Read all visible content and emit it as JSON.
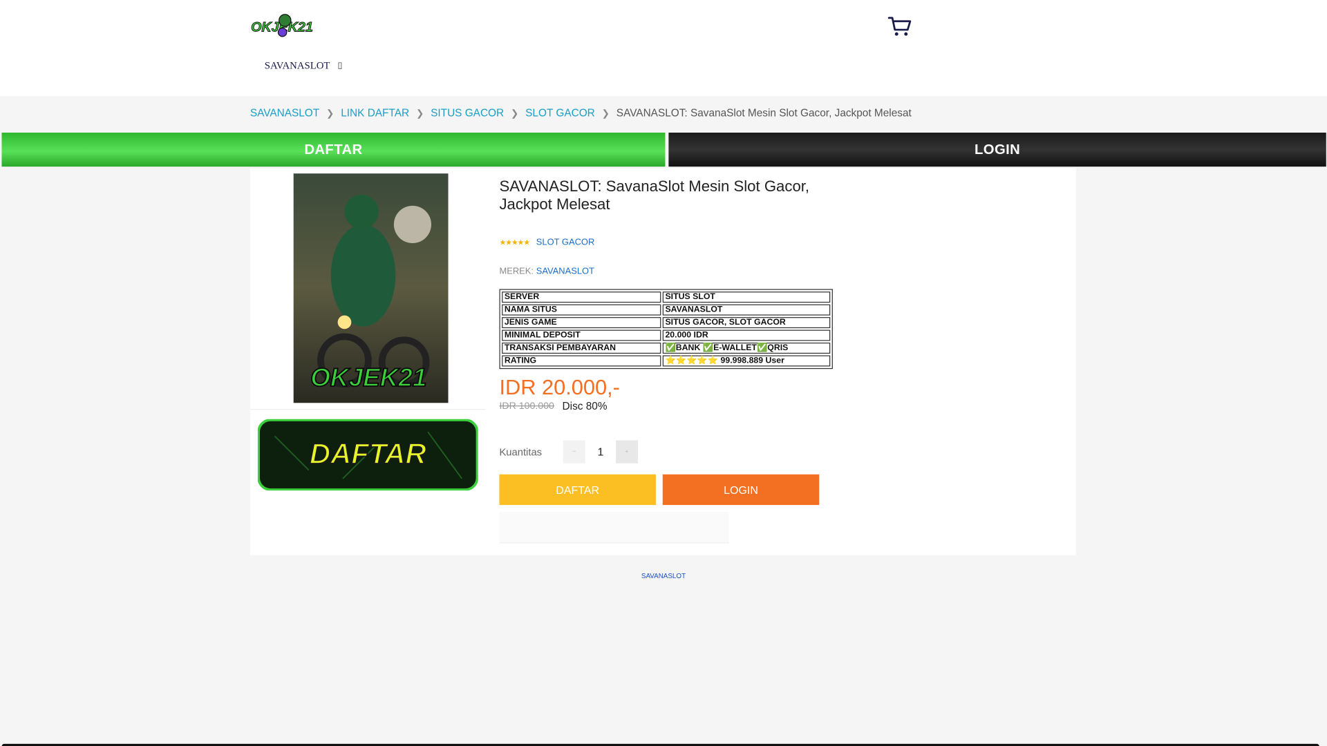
{
  "header": {
    "logo_text": "OKJEK21",
    "nav_label": "SAVANASLOT",
    "nav_icon": "dropdown-box-icon"
  },
  "breadcrumb": {
    "items": [
      "SAVANASLOT",
      "LINK DAFTAR",
      "SITUS GACOR",
      "SLOT GACOR"
    ],
    "current": "SAVANASLOT: SavanaSlot Mesin Slot Gacor, Jackpot Melesat"
  },
  "banner_buttons": {
    "daftar": "DAFTAR",
    "login": "LOGIN"
  },
  "product": {
    "image_alt": "OKJEK21",
    "title": "SAVANASLOT: SavanaSlot Mesin Slot Gacor, Jackpot Melesat",
    "rating_stars": "★★★★★",
    "rating_value": 5,
    "category": "SLOT GACOR",
    "brand_label": "MEREK:",
    "brand_value": "SAVANASLOT",
    "daftar_banner": "DAFTAR",
    "spec": [
      {
        "k": "SERVER",
        "v": "SITUS SLOT"
      },
      {
        "k": "NAMA SITUS",
        "v": "SAVANASLOT"
      },
      {
        "k": "JENIS GAME",
        "v": "SITUS GACOR, SLOT GACOR"
      },
      {
        "k": "MINIMAL DEPOSIT",
        "v": "20.000 IDR"
      },
      {
        "k": "TRANSAKSI PEMBAYARAN",
        "v": "✅BANK ✅E-WALLET✅QRIS"
      },
      {
        "k": "RATING",
        "v": "⭐⭐⭐⭐⭐ 99.998.889 User"
      }
    ],
    "price": "IDR 20.000,-",
    "old_price": "IDR 100.000",
    "discount": "Disc 80%",
    "qty_label": "Kuantitas",
    "qty_value": "1",
    "btn_daftar": "DAFTAR",
    "btn_login": "LOGIN"
  },
  "footer_link": "SAVANASLOT",
  "colors": {
    "accent_orange": "#f36f21",
    "accent_yellow": "#fbbf24",
    "link_blue": "#1a9ec9",
    "green": "#3ccf3c"
  }
}
